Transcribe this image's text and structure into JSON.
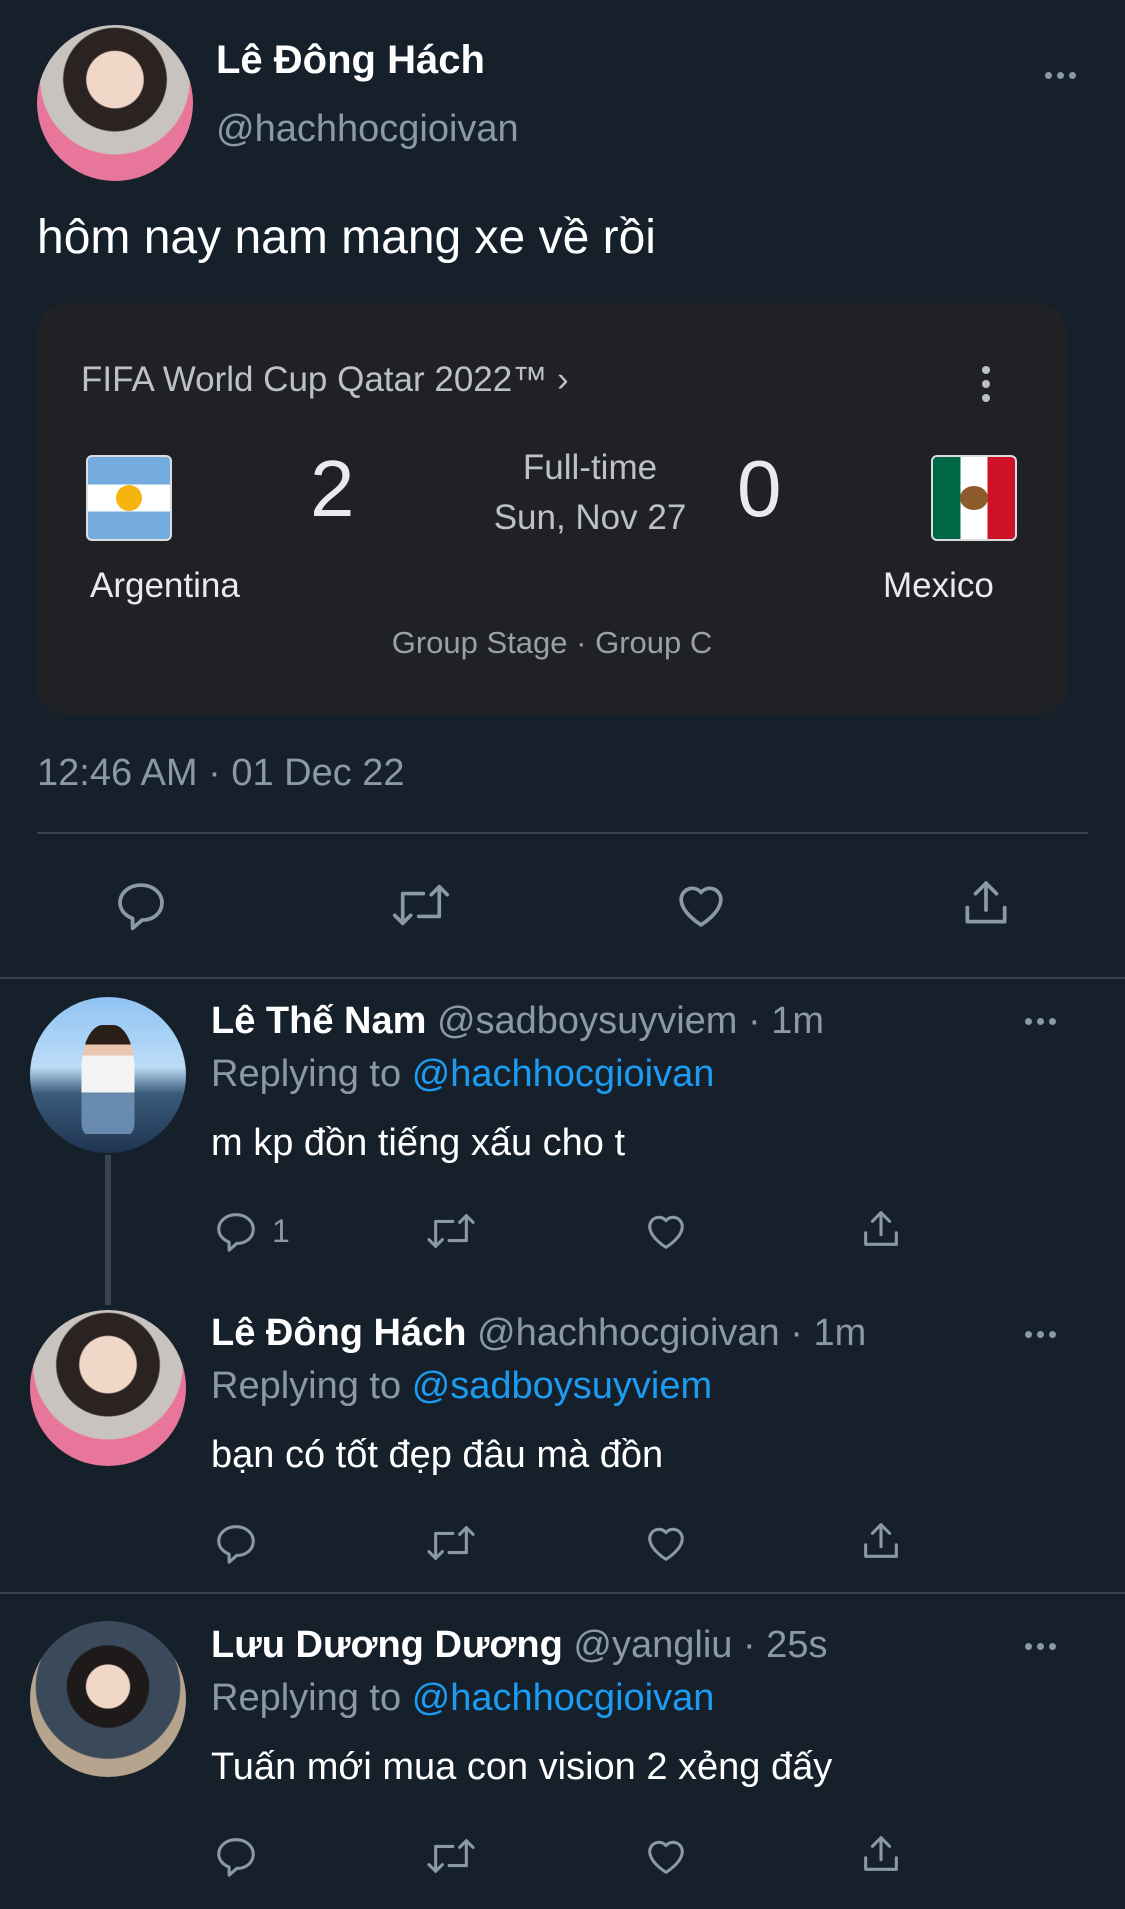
{
  "main_tweet": {
    "author_name": "Lê Đông Hách",
    "author_handle": "@hachhocgioivan",
    "text": "hôm nay nam mang xe về rồi",
    "timestamp": "12:46 AM · 01 Dec 22",
    "card": {
      "title": "FIFA World Cup Qatar 2022™ ›",
      "home_team": "Argentina",
      "away_team": "Mexico",
      "home_score": "2",
      "away_score": "0",
      "status": "Full-time",
      "date": "Sun, Nov 27",
      "stage": "Group Stage · Group C"
    }
  },
  "replies": [
    {
      "author_name": "Lê Thế Nam",
      "meta": "@sadboysuyviem · 1m",
      "replying_prefix": "Replying to",
      "replying_to": "@hachhocgioivan",
      "text": "m kp đồn tiếng xấu cho t",
      "reply_count": "1"
    },
    {
      "author_name": "Lê Đông Hách",
      "meta": "@hachhocgioivan · 1m",
      "replying_prefix": "Replying to",
      "replying_to": "@sadboysuyviem",
      "text": "bạn có tốt đẹp đâu mà đồn"
    },
    {
      "author_name": "Lưu Dương Dương",
      "meta": "@yangliu · 25s",
      "replying_prefix": "Replying to",
      "replying_to": "@hachhocgioivan",
      "text": "Tuấn mới mua con vision 2 xẻng đấy"
    }
  ],
  "icons": [
    "reply-icon",
    "retweet-icon",
    "like-icon",
    "share-icon",
    "more-icon"
  ],
  "colors": {
    "background": "#15202b",
    "text": "#ffffff",
    "muted": "#8b98a5",
    "accent": "#1d9bf0",
    "card_bg": "#202124",
    "divider": "#38444d"
  }
}
